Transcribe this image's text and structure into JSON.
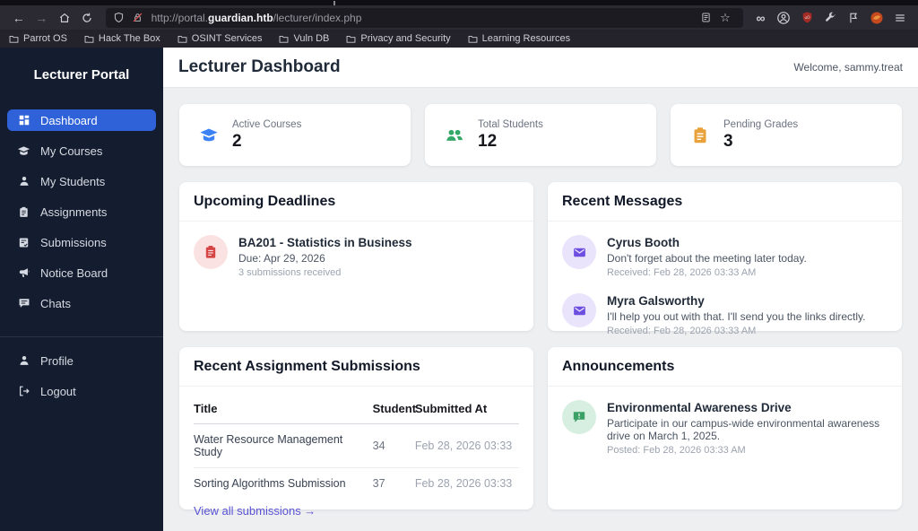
{
  "browser": {
    "url_prefix": "http://portal.",
    "url_domain": "guardian.htb",
    "url_path": "/lecturer/index.php",
    "bookmarks": [
      "Parrot OS",
      "Hack The Box",
      "OSINT Services",
      "Vuln DB",
      "Privacy and Security",
      "Learning Resources"
    ]
  },
  "colors": {
    "accent_blue": "#2f62d9",
    "stat_blue": "#3b82f6",
    "stat_green": "#34a866",
    "stat_orange": "#e9a23b",
    "deadline_red": "#d64545",
    "message_purple": "#6d4ee0",
    "announce_green": "#3aa065",
    "link_indigo": "#5a52d5",
    "sidebar_bg": "#141d2f"
  },
  "sidebar": {
    "title": "Lecturer Portal",
    "items": [
      {
        "label": "Dashboard"
      },
      {
        "label": "My Courses"
      },
      {
        "label": "My Students"
      },
      {
        "label": "Assignments"
      },
      {
        "label": "Submissions"
      },
      {
        "label": "Notice Board"
      },
      {
        "label": "Chats"
      }
    ],
    "footer_items": [
      {
        "label": "Profile"
      },
      {
        "label": "Logout"
      }
    ]
  },
  "header": {
    "title": "Lecturer Dashboard",
    "welcome": "Welcome, sammy.treat"
  },
  "stats": [
    {
      "label": "Active Courses",
      "value": "2"
    },
    {
      "label": "Total Students",
      "value": "12"
    },
    {
      "label": "Pending Grades",
      "value": "3"
    }
  ],
  "deadlines": {
    "card_title": "Upcoming Deadlines",
    "items": [
      {
        "title": "BA201 - Statistics in Business",
        "due": "Due: Apr 29, 2026",
        "note": "3 submissions received"
      }
    ]
  },
  "messages": {
    "card_title": "Recent Messages",
    "items": [
      {
        "name": "Cyrus Booth",
        "preview": "Don't forget about the meeting later today.",
        "received": "Received: Feb 28, 2026 03:33 AM"
      },
      {
        "name": "Myra Galsworthy",
        "preview": "I'll help you out with that. I'll send you the links directly.",
        "received": "Received: Feb 28, 2026 03:33 AM"
      }
    ]
  },
  "submissions": {
    "card_title": "Recent Assignment Submissions",
    "columns": [
      "Title",
      "Student",
      "Submitted At"
    ],
    "rows": [
      {
        "title": "Water Resource Management Study",
        "student": "34",
        "submitted": "Feb 28, 2026 03:33"
      },
      {
        "title": "Sorting Algorithms Submission",
        "student": "37",
        "submitted": "Feb 28, 2026 03:33"
      }
    ],
    "link": "View all submissions →"
  },
  "announcements": {
    "card_title": "Announcements",
    "items": [
      {
        "title": "Environmental Awareness Drive",
        "body": "Participate in our campus-wide environmental awareness drive on March 1, 2025.",
        "posted": "Posted: Feb 28, 2026 03:33 AM"
      }
    ]
  }
}
